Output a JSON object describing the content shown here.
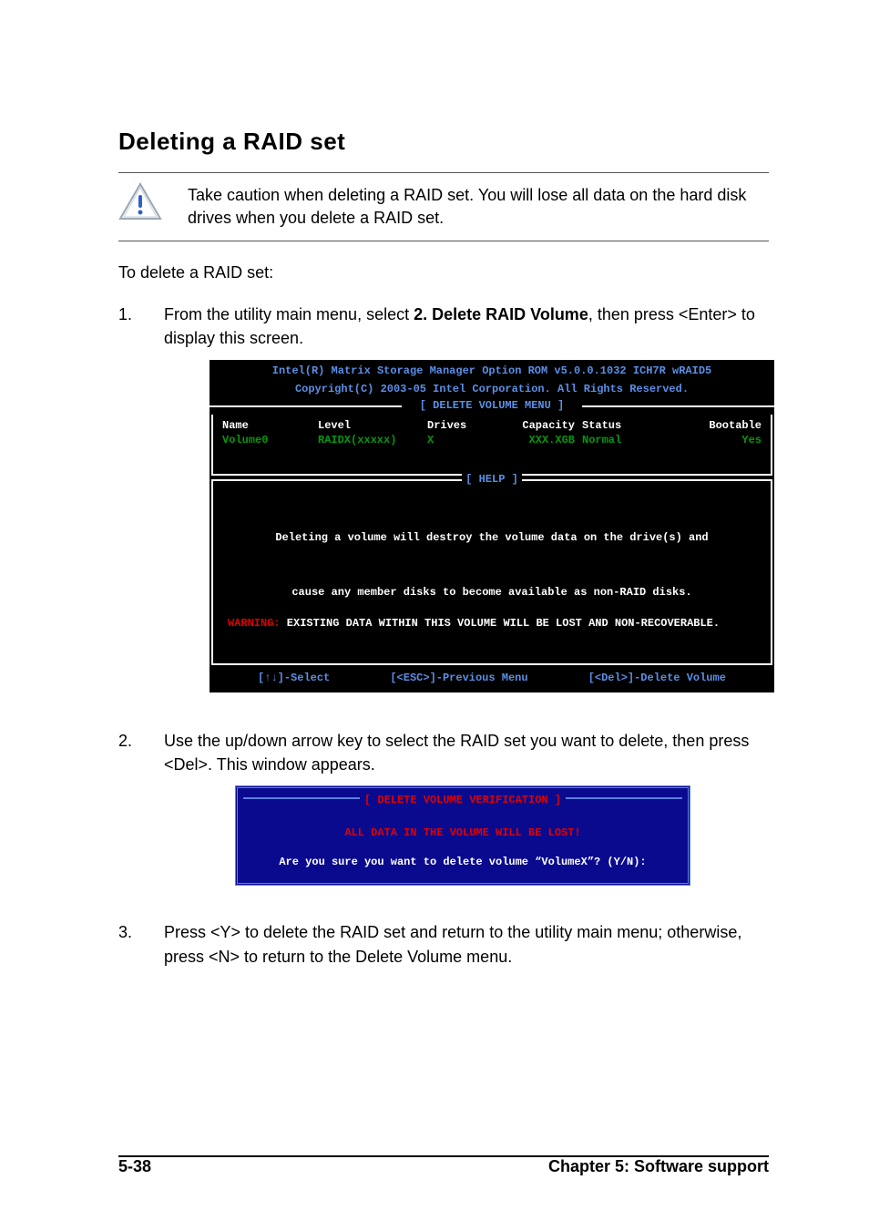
{
  "heading": "Deleting a RAID set",
  "caution": "Take caution when deleting a RAID set. You will lose all data on the hard disk drives when you delete a RAID set.",
  "intro": "To delete a RAID set:",
  "steps": {
    "s1_num": "1.",
    "s1_pre": "From the utility main menu, select ",
    "s1_bold": "2. Delete RAID Volume",
    "s1_post": ", then press <Enter> to display this screen.",
    "s2_num": "2.",
    "s2": "Use the up/down arrow key to select the RAID set you want to delete, then press <Del>. This window appears.",
    "s3_num": "3.",
    "s3": "Press <Y> to delete the RAID set and return to the utility main menu; otherwise, press <N> to return to the Delete Volume menu."
  },
  "bios1": {
    "title1": "Intel(R) Matrix Storage Manager Option ROM v5.0.0.1032 ICH7R wRAID5",
    "title2": "Copyright(C) 2003-05 Intel Corporation. All Rights Reserved.",
    "section_label": "[ DELETE VOLUME MENU ]",
    "cols": {
      "name": "Name",
      "level": "Level",
      "drives": "Drives",
      "capacity": "Capacity",
      "status": "Status",
      "bootable": "Bootable"
    },
    "row": {
      "name": "Volume0",
      "level": "RAIDX(xxxxx)",
      "drives": "X",
      "capacity": "XXX.XGB",
      "status": "Normal",
      "bootable": "Yes"
    },
    "help_label": "[ HELP ]",
    "help_line1": "Deleting a volume will destroy the volume data on the drive(s) and",
    "help_line2": "cause any member disks to become available as non-RAID disks.",
    "warn_prefix": "WARNING:",
    "warn_rest": " EXISTING DATA WITHIN THIS VOLUME WILL BE LOST AND NON-RECOVERABLE.",
    "footer_select": "[↑↓]-Select",
    "footer_prev": "[<ESC>]-Previous Menu",
    "footer_del": "[<Del>]-Delete Volume"
  },
  "bios2": {
    "title": "[ DELETE VOLUME VERIFICATION ]",
    "lost": "ALL DATA IN THE VOLUME WILL BE LOST!",
    "ask": "Are you sure you want to delete volume “VolumeX”? (Y/N):"
  },
  "footer": {
    "left": "5-38",
    "right": "Chapter 5: Software support"
  }
}
